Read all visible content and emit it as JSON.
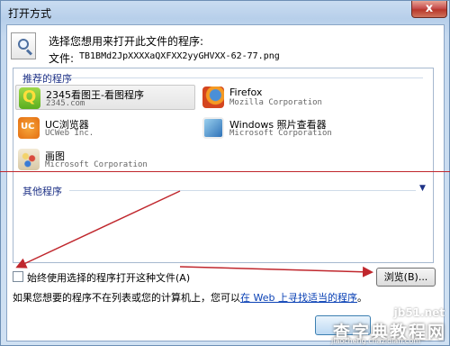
{
  "window": {
    "title": "打开方式",
    "close_label": "x"
  },
  "prompt": {
    "text": "选择您想用来打开此文件的程序:",
    "file_label": "文件:",
    "file_name": "TB1BMd2JpXXXXaQXFXX2yyGHVXX-62-77.png"
  },
  "recommended": {
    "header": "推荐的程序",
    "items": [
      {
        "name": "2345看图王-看图程序",
        "company": "2345.com",
        "icon": "2345-viewer-icon",
        "selected": true
      },
      {
        "name": "Firefox",
        "company": "Mozilla Corporation",
        "icon": "firefox-icon"
      },
      {
        "name": "UC浏览器",
        "company": "UCWeb Inc.",
        "icon": "uc-browser-icon"
      },
      {
        "name": "Windows 照片查看器",
        "company": "Microsoft Corporation",
        "icon": "photo-viewer-icon"
      },
      {
        "name": "画图",
        "company": "Microsoft Corporation",
        "icon": "paint-icon"
      }
    ]
  },
  "other": {
    "header": "其他程序",
    "expand_icon": "chevron-down-icon"
  },
  "options": {
    "always_use_label": "始终使用选择的程序打开这种文件(A)",
    "always_use_checked": false,
    "browse_label": "浏览(B)..."
  },
  "footer": {
    "text": "如果您想要的程序不在列表或您的计算机上，您可以",
    "link": "在 Web 上寻找适当的程序",
    "suffix": "。"
  },
  "watermark": {
    "site": "jb51.net",
    "main": "查字典教程网",
    "sub": "jiaocheng.chazidian.com"
  },
  "annotation_color": "#c0272d"
}
